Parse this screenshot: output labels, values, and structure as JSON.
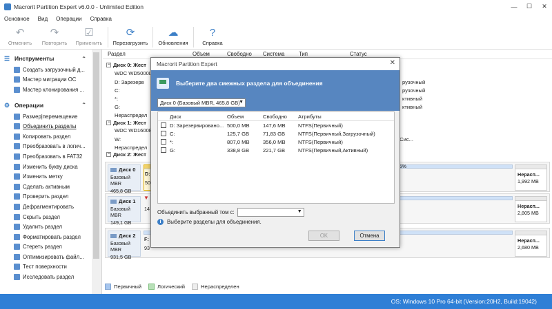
{
  "window": {
    "title": "Macrorit Partition Expert v6.0.0 - Unlimited Edition",
    "controls": [
      "—",
      "☐",
      "✕"
    ]
  },
  "menu": [
    "Основное",
    "Вид",
    "Операции",
    "Справка"
  ],
  "toolbar": {
    "undo": "Отменить",
    "redo": "Повторить",
    "apply": "Применить",
    "reboot": "Перезагрузить",
    "updates": "Обновления",
    "help": "Справка"
  },
  "sidebar": {
    "tools_title": "Инструменты",
    "tools": [
      "Создать загрузочный д...",
      "Мастер миграции ОС",
      "Мастер клонирования ..."
    ],
    "ops_title": "Операции",
    "ops": [
      "Размер|перемещение",
      "Объединить разделы",
      "Копировать раздел",
      "Преобразовать в логич...",
      "Преобразовать в FAT32",
      "Изменить букву диска",
      "Изменить метку",
      "Сделать активным",
      "Проверить раздел",
      "Дефрагментировать",
      "Скрыть раздел",
      "Удалить раздел",
      "Форматировать раздел",
      "Стереть раздел",
      "Оптимизировать файл...",
      "Тест поверхности",
      "Исследовать раздел"
    ]
  },
  "main": {
    "columns": [
      "Раздел",
      "Объем",
      "Свободно",
      "Система",
      "Тип",
      "Статус"
    ],
    "tree": [
      {
        "text": "Диск 0: Жест",
        "bold": true
      },
      {
        "text": "WDC WD5000L",
        "bold": false
      },
      {
        "text": "D: Зарезерв",
        "bold": false
      },
      {
        "text": "C:",
        "bold": false
      },
      {
        "text": "*:",
        "bold": false
      },
      {
        "text": "G:",
        "bold": false
      },
      {
        "text": "Нераспредел",
        "bold": false
      },
      {
        "text": "Диск 1: Жест",
        "bold": true
      },
      {
        "text": "WDC WD1600E",
        "bold": false
      },
      {
        "text": "W:",
        "bold": false
      },
      {
        "text": "Нераспредел",
        "bold": false
      },
      {
        "text": "Диск 2: Жест",
        "bold": true
      }
    ],
    "status_fragments": [
      "рузочный",
      "рузочный",
      "ктивный",
      "ктивный",
      ",Сис..."
    ],
    "disks": [
      {
        "name": "Диск 0",
        "type": "Базовый MBR",
        "size": "465,8 GB",
        "part_label": "D:",
        "part_size": "50",
        "pct": "35%",
        "unalloc": "Нерасп...",
        "unalloc_size": "1,992 MB"
      },
      {
        "name": "Диск 1",
        "type": "Базовый MBR",
        "size": "149,1 GB",
        "part_label": "W:",
        "part_size": "14",
        "unalloc": "Нерасп...",
        "unalloc_size": "2,805 MB"
      },
      {
        "name": "Диск 2",
        "type": "Базовый MBR",
        "size": "931,5 GB",
        "part_label": "F:",
        "part_size": "93",
        "unalloc": "Нерасп...",
        "unalloc_size": "2,680 MB"
      }
    ]
  },
  "legend": [
    "Первичный",
    "Логический",
    "Нераспределен"
  ],
  "statusbar": "OS: Windows 10 Pro 64-bit (Version:20H2, Build:19042)",
  "dialog": {
    "title": "Macrorit Partition Expert",
    "close": "✕",
    "header": "Выберите два смежных раздела для объединения",
    "disk_select": "Диск 0 (Базовый MBR, 465,8 GB)",
    "columns": [
      "Диск",
      "Объем",
      "Свободно",
      "Атрибуты"
    ],
    "rows": [
      {
        "disk": "D: Зарезервировано...",
        "size": "500,0 MB",
        "free": "147,6 MB",
        "attr": "NTFS(Первичный)"
      },
      {
        "disk": "C:",
        "size": "125,7 GB",
        "free": "71,83 GB",
        "attr": "NTFS(Первичный,Загрузочный)"
      },
      {
        "disk": "*:",
        "size": "807,0 MB",
        "free": "356,0 MB",
        "attr": "NTFS(Первичный)"
      },
      {
        "disk": "G:",
        "size": "338,8 GB",
        "free": "221,7 GB",
        "attr": "NTFS(Первичный,Активный)"
      }
    ],
    "merge_label": "Объединить выбранный том с:",
    "info": "Выберите разделы для объединения.",
    "ok": "OK",
    "cancel": "Отмена"
  }
}
